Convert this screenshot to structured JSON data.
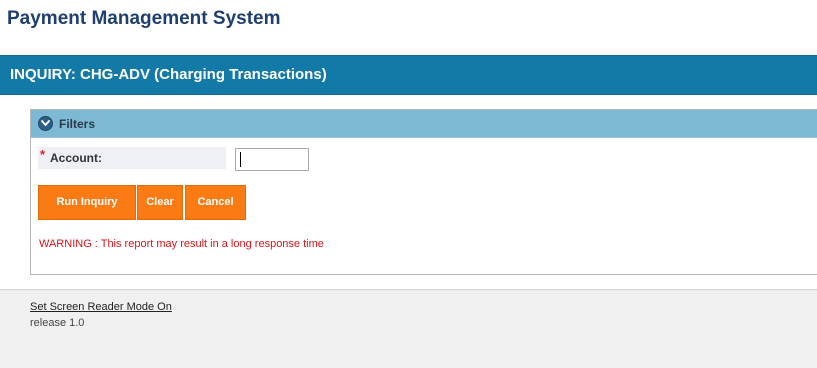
{
  "app": {
    "title": "Payment Management System"
  },
  "page": {
    "title": "INQUIRY: CHG-ADV (Charging Transactions)"
  },
  "filters": {
    "title": "Filters",
    "toggle_icon": "chevron-down-icon",
    "account": {
      "required_marker": "*",
      "label": "Account:",
      "value": ""
    },
    "buttons": {
      "run_label": "Run Inquiry",
      "clear_label": "Clear",
      "cancel_label": "Cancel"
    },
    "warning": "WARNING : This report may result in a long response time"
  },
  "footer": {
    "screen_reader_link": "Set Screen Reader Mode On",
    "release": "release 1.0"
  },
  "colors": {
    "banner": "#1379a6",
    "filters_header": "#7db9d4",
    "button": "#fa7a14",
    "warning": "#d8141b",
    "title": "#1f3f6e"
  }
}
